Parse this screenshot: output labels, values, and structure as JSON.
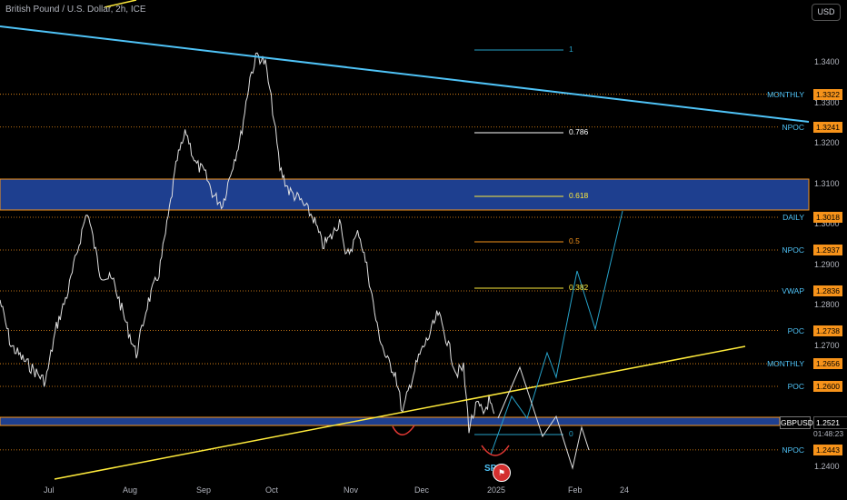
{
  "header": {
    "title": "British Pound / U.S. Dollar, 2h, ICE",
    "currency": "USD"
  },
  "colors": {
    "price_line": "#e0e0e0",
    "channel_upper": "#4fc3f7",
    "channel_lower": "#ffeb3b",
    "zone_fill": "#1e3f8f",
    "zone_border": "#f7931a",
    "level_line": "#f7931a",
    "projection": "#26a2c9",
    "label_tag": "#f7931a"
  },
  "price_axis": {
    "ticks": [
      "1.3400",
      "1.3300",
      "1.3200",
      "1.3100",
      "1.3000",
      "1.2900",
      "1.2800",
      "1.2700",
      "1.2600",
      "1.2500",
      "1.2400"
    ]
  },
  "time_axis": {
    "ticks": [
      "Jul",
      "Aug",
      "Sep",
      "Oct",
      "Nov",
      "Dec",
      "2025",
      "Feb",
      "24"
    ]
  },
  "levels": [
    {
      "name": "MONTHLY",
      "price": "1.3322"
    },
    {
      "name": "NPOC",
      "price": "1.3241"
    },
    {
      "name": "DAILY",
      "price": "1.3018"
    },
    {
      "name": "NPOC",
      "price": "1.2937"
    },
    {
      "name": "VWAP",
      "price": "1.2836"
    },
    {
      "name": "POC",
      "price": "1.2738"
    },
    {
      "name": "MONTHLY",
      "price": "1.2656"
    },
    {
      "name": "POC",
      "price": "1.2600"
    },
    {
      "name": "NPOC",
      "price": "1.2443"
    }
  ],
  "fib_levels": [
    {
      "label": "1",
      "color": "#26a2c9"
    },
    {
      "label": "0.786",
      "color": "#ffffff"
    },
    {
      "label": "0.618",
      "color": "#ffeb3b"
    },
    {
      "label": "0.5",
      "color": "#f7931a"
    },
    {
      "label": "0.382",
      "color": "#ffeb3b"
    },
    {
      "label": "0",
      "color": "#26a2c9"
    }
  ],
  "last": {
    "symbol": "GBPUSD",
    "price": "1.2521",
    "countdown": "01:48:23"
  },
  "marker": {
    "label": "SP"
  }
}
